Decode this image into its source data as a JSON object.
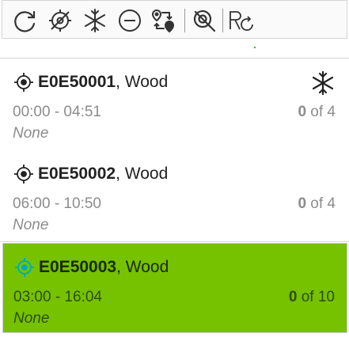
{
  "toolbar": {
    "icons": [
      "refresh-icon",
      "no-location-icon",
      "freeze-icon",
      "minus-circle-icon",
      "swap-route-icon",
      "no-search-icon",
      "registered-refresh-icon"
    ]
  },
  "colors": {
    "selected_bg": "#76c100",
    "muted_text": "#8c8c8c",
    "target_selected": "#00a9c8"
  },
  "items": [
    {
      "code": "E0E50001",
      "material": ", Wood",
      "time": "00:00 - 04:51",
      "count_num": "0",
      "count_rest": " of 4",
      "note": "None",
      "frozen": true,
      "selected": false
    },
    {
      "code": "E0E50002",
      "material": ", Wood",
      "time": "06:00 - 10:50",
      "count_num": "0",
      "count_rest": " of 4",
      "note": "None",
      "frozen": false,
      "selected": false
    },
    {
      "code": "E0E50003",
      "material": ", Wood",
      "time": "03:00 - 16:04",
      "count_num": "0",
      "count_rest": " of 10",
      "note": "None",
      "frozen": false,
      "selected": true
    }
  ]
}
